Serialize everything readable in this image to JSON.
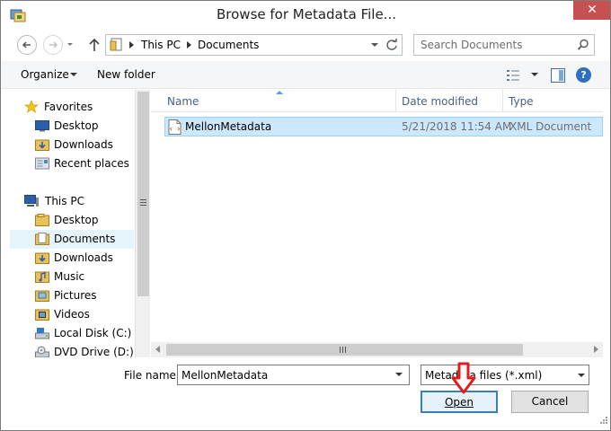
{
  "window": {
    "title": "Browse for Metadata File...",
    "close_label": "✕"
  },
  "nav": {
    "address": [
      "This PC",
      "Documents"
    ],
    "search_placeholder": "Search Documents"
  },
  "toolbar": {
    "organize_label": "Organize",
    "new_folder_label": "New folder",
    "help_label": "?"
  },
  "sidebar": {
    "favorites_label": "Favorites",
    "favorites": [
      "Desktop",
      "Downloads",
      "Recent places"
    ],
    "thispc_label": "This PC",
    "thispc": [
      "Desktop",
      "Documents",
      "Downloads",
      "Music",
      "Pictures",
      "Videos",
      "Local Disk (C:)",
      "DVD Drive (D:) IR"
    ],
    "selected": "Documents"
  },
  "columns": {
    "name": "Name",
    "date": "Date modified",
    "type": "Type"
  },
  "files": [
    {
      "name": "MellonMetadata",
      "date": "5/21/2018 11:54 AM",
      "type": "XML Document"
    }
  ],
  "bottom": {
    "filename_label": "File name:",
    "filename_value": "MellonMetadata",
    "filetype_value": "Metadata files (*.xml)",
    "open_label": "Open",
    "cancel_label": "Cancel"
  },
  "colors": {
    "selection": "#cce8ff",
    "close_button": "#c75050",
    "annotation_arrow": "#e31b1b"
  }
}
